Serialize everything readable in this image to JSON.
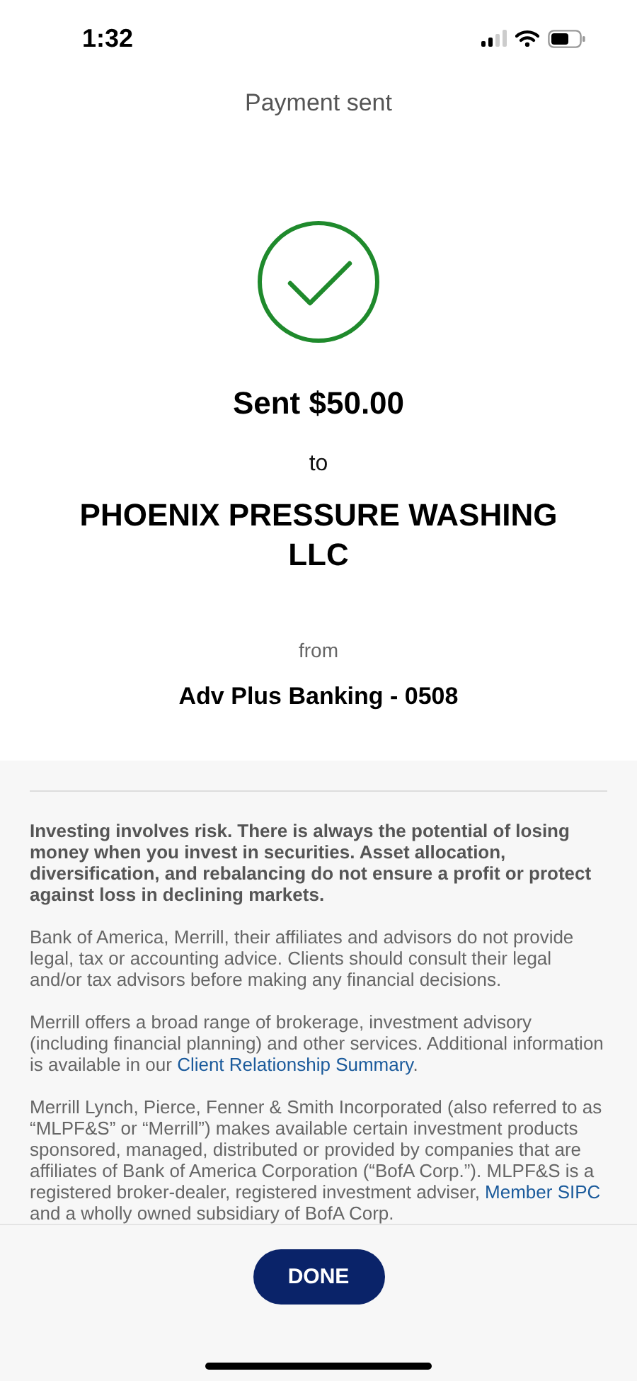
{
  "status_bar": {
    "time": "1:32"
  },
  "header": {
    "title": "Payment sent"
  },
  "confirmation": {
    "amount": "Sent $50.00",
    "to_label": "to",
    "payee": "PHOENIX PRESSURE WASHING LLC",
    "from_label": "from",
    "account": "Adv Plus Banking - 0508"
  },
  "disclosures": [
    {
      "bold": true,
      "segments": [
        {
          "kind": "text",
          "text": "Investing involves risk. There is always the potential of losing money when you invest in securities. Asset allocation, diversification, and rebalancing do not ensure a profit or protect against loss in declining markets."
        }
      ]
    },
    {
      "bold": false,
      "segments": [
        {
          "kind": "text",
          "text": "Bank of America, Merrill, their affiliates and advisors do not provide legal, tax or accounting advice. Clients should consult their legal and/or tax advisors before making any financial decisions."
        }
      ]
    },
    {
      "bold": false,
      "segments": [
        {
          "kind": "text",
          "text": "Merrill offers a broad range of brokerage, investment advisory (including financial planning) and other services. Additional information is available in our "
        },
        {
          "kind": "link",
          "text": "Client Relationship Summary"
        },
        {
          "kind": "text",
          "text": "."
        }
      ]
    },
    {
      "bold": false,
      "segments": [
        {
          "kind": "text",
          "text": "Merrill Lynch, Pierce, Fenner & Smith Incorporated (also referred to as “MLPF&S” or “Merrill”) makes available certain investment products sponsored, managed, distributed or provided by companies that are affiliates of Bank of America Corporation (“BofA Corp.”). MLPF&S is a registered broker-dealer, registered investment adviser, "
        },
        {
          "kind": "link",
          "text": "Member SIPC"
        },
        {
          "kind": "text",
          "text": " and a wholly owned subsidiary of BofA Corp."
        }
      ]
    }
  ],
  "footer": {
    "button": "DONE"
  }
}
